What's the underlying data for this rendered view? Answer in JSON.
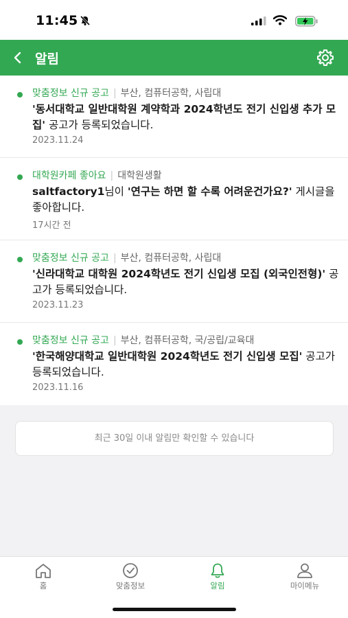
{
  "status": {
    "time": "11:45"
  },
  "header": {
    "title": "알림"
  },
  "notifications": [
    {
      "category": "맞춤정보 신규 공고",
      "tags": "부산, 컴퓨터공학, 사립대",
      "title": "'동서대학교 일반대학원 계약학과 2024학년도 전기 신입생 추가 모집'",
      "suffix": "공고가 등록되었습니다.",
      "date": "2023.11.24"
    },
    {
      "category": "대학원카페 좋아요",
      "tags": "대학원생활",
      "user": "saltfactory1",
      "user_suffix": "님이",
      "title": "'연구는 하면 할 수록 어려운건가요?'",
      "suffix": "게시글을 좋아합니다.",
      "date": "17시간 전"
    },
    {
      "category": "맞춤정보 신규 공고",
      "tags": "부산, 컴퓨터공학, 사립대",
      "title": "'신라대학교 대학원 2024학년도 전기 신입생 모집 (외국인전형)'",
      "suffix": "공고가 등록되었습니다.",
      "date": "2023.11.23"
    },
    {
      "category": "맞춤정보 신규 공고",
      "tags": "부산, 컴퓨터공학, 국/공립/교육대",
      "title": "'한국해양대학교 일반대학원 2024학년도 전기 신입생 모집'",
      "suffix": "공고가 등록되었습니다.",
      "date": "2023.11.16"
    }
  ],
  "notice": "최근 30일 이내 알림만 확인할 수 있습니다",
  "tabs": [
    {
      "label": "홈",
      "icon": "home-icon"
    },
    {
      "label": "맞춤정보",
      "icon": "check-circle-icon"
    },
    {
      "label": "알림",
      "icon": "bell-icon",
      "active": true
    },
    {
      "label": "마이메뉴",
      "icon": "person-icon"
    }
  ],
  "colors": {
    "accent": "#33a853"
  }
}
